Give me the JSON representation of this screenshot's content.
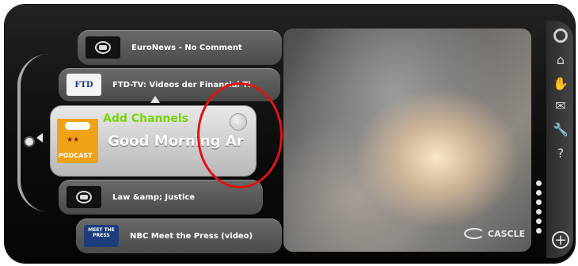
{
  "channels": [
    {
      "name": "EuroNews - No Comment",
      "thumb_text": ""
    },
    {
      "name": "FTD-TV: Videos der Financial Ti",
      "thumb_text": "FTD"
    },
    {
      "name": "Law &amp; Justice",
      "thumb_text": ""
    },
    {
      "name": "NBC Meet the Press (video)",
      "thumb_text": "MEET THE PRESS"
    }
  ],
  "selected": {
    "add_channels_label": "Add Channels",
    "title": "Good Morning Ar",
    "thumb_badge": "PODCAST"
  },
  "brand": {
    "name": "CASCLE"
  },
  "sidebar_icons": [
    "power-icon",
    "home-icon",
    "handshake-icon",
    "mail-icon",
    "wrench-icon",
    "help-icon"
  ],
  "plus_label": "+",
  "colors": {
    "accent_green": "#79d40c",
    "highlight_circle": "#e01212"
  }
}
